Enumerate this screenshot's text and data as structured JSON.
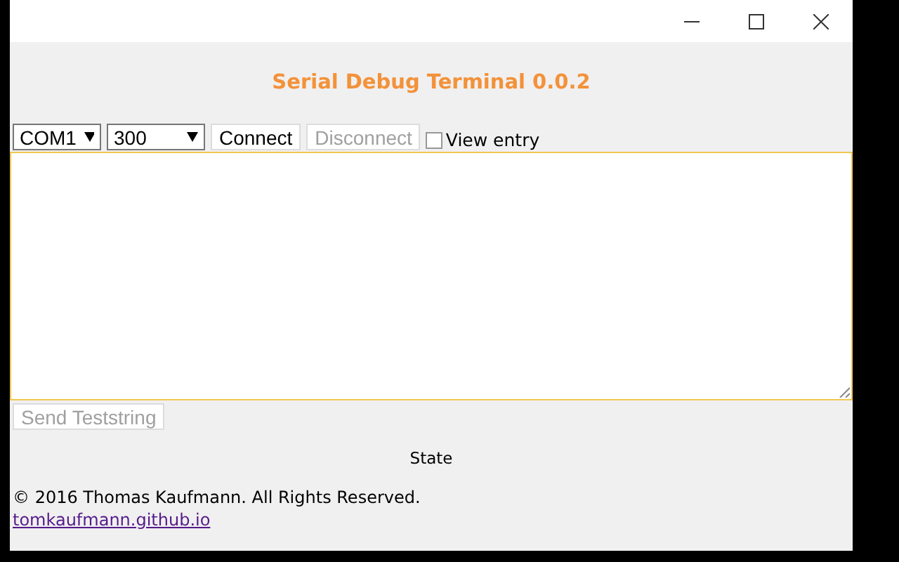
{
  "title": "Serial Debug Terminal 0.0.2",
  "toolbar": {
    "port": {
      "value": "COM1"
    },
    "baud": {
      "value": "300"
    },
    "buttons": [
      {
        "label": "Connect",
        "disabled": false
      },
      {
        "label": "Disconnect",
        "disabled": true
      }
    ],
    "view_entry": {
      "label": "View entry",
      "checked": false
    }
  },
  "output": {
    "focused": true
  },
  "send_button": {
    "label": "Send Teststring",
    "disabled": true
  },
  "state": "State",
  "footer": {
    "copyright": "© 2016 Thomas Kaufmann. All Rights Reserved.",
    "link": "tomkaufmann.github.io"
  }
}
